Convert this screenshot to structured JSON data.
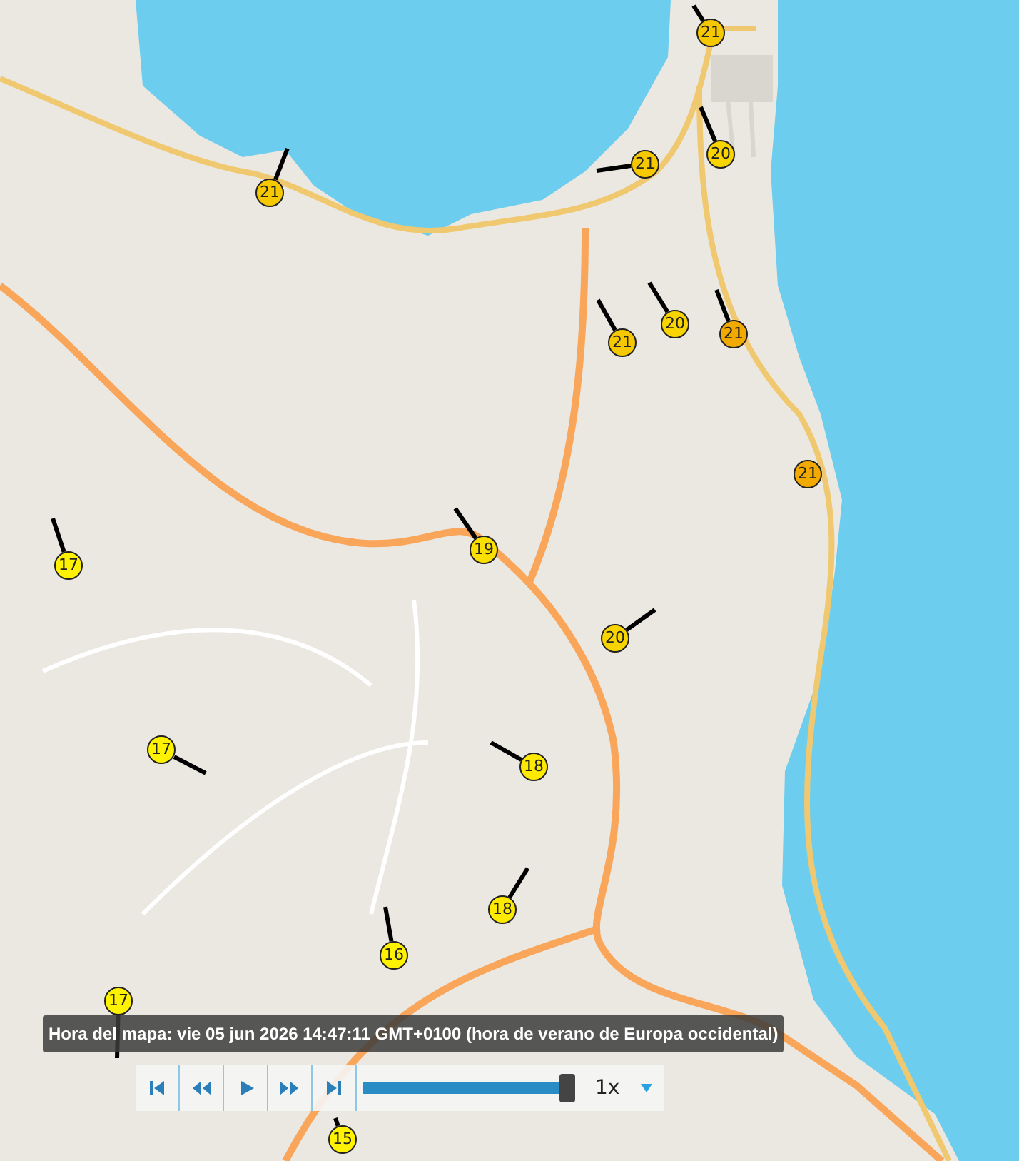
{
  "map": {
    "stations": [
      {
        "value": "21",
        "color": "#f6c800"
      },
      {
        "value": "21",
        "color": "#f6c800"
      },
      {
        "value": "21",
        "color": "#f6c800"
      },
      {
        "value": "20",
        "color": "#f8d400"
      },
      {
        "value": "21",
        "color": "#f6c800"
      },
      {
        "value": "20",
        "color": "#f8d400"
      },
      {
        "value": "21",
        "color": "#f2a900"
      },
      {
        "value": "21",
        "color": "#f2a900"
      },
      {
        "value": "19",
        "color": "#fadf00"
      },
      {
        "value": "20",
        "color": "#f8d400"
      },
      {
        "value": "17",
        "color": "#fff200"
      },
      {
        "value": "17",
        "color": "#fff200"
      },
      {
        "value": "18",
        "color": "#fdea00"
      },
      {
        "value": "18",
        "color": "#fdea00"
      },
      {
        "value": "16",
        "color": "#fff200"
      },
      {
        "value": "17",
        "color": "#fff200"
      },
      {
        "value": "15",
        "color": "#fff200"
      }
    ]
  },
  "map_time": "Hora del mapa: vie 05 jun 2026 14:47:11 GMT+0100 (hora de verano de Europa occidental)",
  "playback": {
    "buttons": [
      {
        "kind": "first"
      },
      {
        "kind": "back"
      },
      {
        "kind": "play"
      },
      {
        "kind": "forward"
      },
      {
        "kind": "last"
      }
    ],
    "timeline": {
      "level": 1
    },
    "speed": "1x"
  }
}
